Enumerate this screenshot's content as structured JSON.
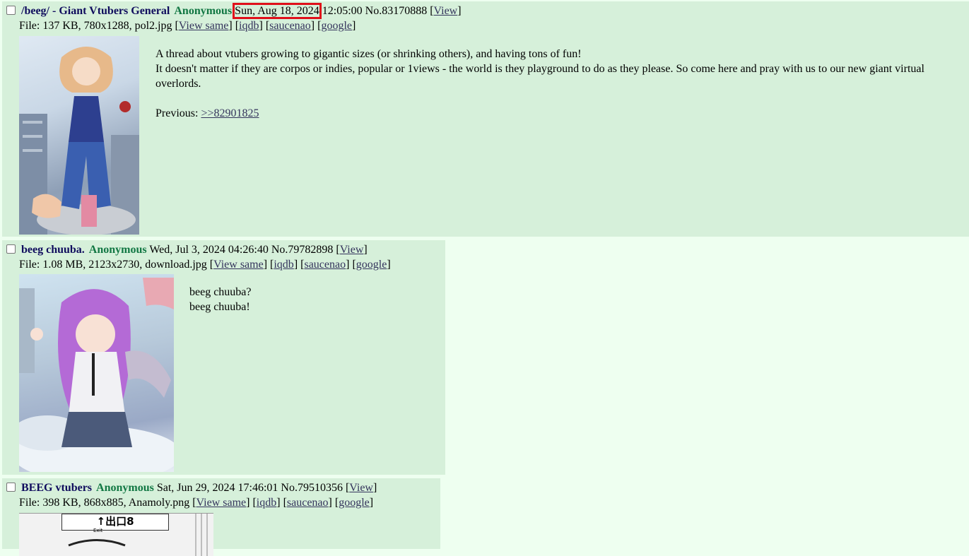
{
  "posts": [
    {
      "subject": "/beeg/ - Giant Vtubers General",
      "name": "Anonymous",
      "date": "Sun, Aug 18, 2024",
      "time": "12:05:00",
      "number": "No.83170888",
      "view_label": "View",
      "file": {
        "prefix": "File:",
        "size": "137 KB,",
        "dims": "780x1288,",
        "filename": "pol2.jpg"
      },
      "links": {
        "view_same": "View same",
        "iqdb": "iqdb",
        "saucenao": "saucenao",
        "google": "google"
      },
      "body": {
        "line1": "A thread about vtubers growing to gigantic sizes (or shrinking others), and having tons of fun!",
        "line2": "It doesn't matter if they are corpos or indies, popular or 1views - the world is they playground to do as they please. So come here and pray with us to our new giant virtual overlords.",
        "previous_label": "Previous:",
        "previous_link": ">>82901825"
      },
      "highlight_color": "#e0101a"
    },
    {
      "subject": "beeg chuuba.",
      "name": "Anonymous",
      "datetime": "Wed, Jul 3, 2024 04:26:40",
      "number": "No.79782898",
      "view_label": "View",
      "file": {
        "prefix": "File:",
        "size": "1.08 MB,",
        "dims": "2123x2730,",
        "filename": "download.jpg"
      },
      "links": {
        "view_same": "View same",
        "iqdb": "iqdb",
        "saucenao": "saucenao",
        "google": "google"
      },
      "body": {
        "line1": "beeg chuuba?",
        "line2": "beeg chuuba!"
      }
    },
    {
      "subject": "BEEG vtubers",
      "name": "Anonymous",
      "datetime": "Sat, Jun 29, 2024 17:46:01",
      "number": "No.79510356",
      "view_label": "View",
      "file": {
        "prefix": "File:",
        "size": "398 KB,",
        "dims": "868x885,",
        "filename": "Anamoly.png"
      },
      "links": {
        "view_same": "View same",
        "iqdb": "iqdb",
        "saucenao": "saucenao",
        "google": "google"
      },
      "thumb_sign": {
        "text": "出口8",
        "sub": "Exit"
      }
    }
  ],
  "colors": {
    "page_bg": "#eefff0",
    "post_bg": "#d6f0da",
    "subject": "#0f0c5d",
    "name": "#117743",
    "link": "#34345c"
  }
}
